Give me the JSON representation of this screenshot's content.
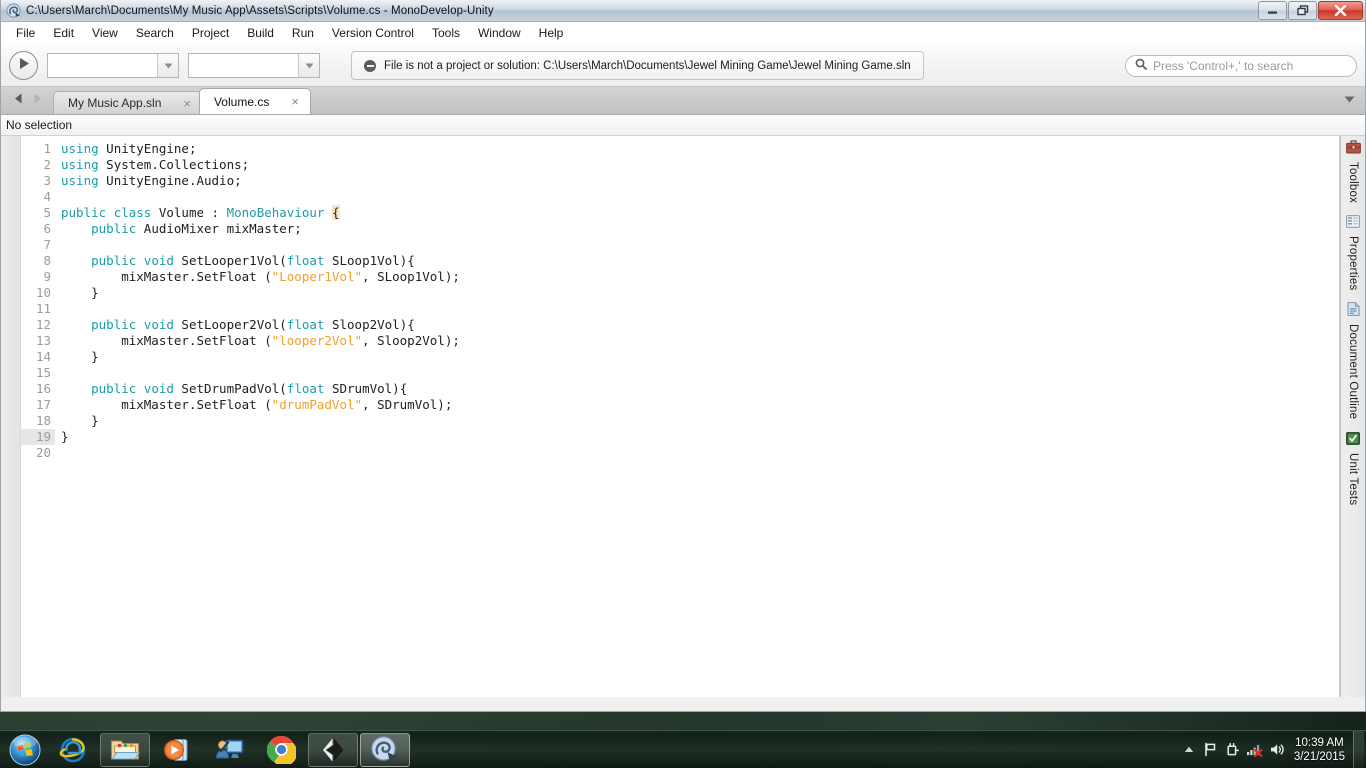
{
  "window": {
    "title": "C:\\Users\\March\\Documents\\My Music App\\Assets\\Scripts\\Volume.cs - MonoDevelop-Unity",
    "app_icon": "monodevelop-icon",
    "controls": {
      "minimize": "minimize-icon",
      "restore": "restore-icon",
      "close": "close-icon"
    }
  },
  "menubar": {
    "items": [
      {
        "label": "File"
      },
      {
        "label": "Edit"
      },
      {
        "label": "View"
      },
      {
        "label": "Search"
      },
      {
        "label": "Project"
      },
      {
        "label": "Build"
      },
      {
        "label": "Run"
      },
      {
        "label": "Version Control"
      },
      {
        "label": "Tools"
      },
      {
        "label": "Window"
      },
      {
        "label": "Help"
      }
    ]
  },
  "toolbar": {
    "run_button": "run-play-icon",
    "combo_configuration": {
      "value": "",
      "arrow": "chevron-down-icon"
    },
    "combo_target": {
      "value": "",
      "arrow": "chevron-down-icon"
    },
    "status": {
      "icon": "error-minus-icon",
      "message": "File is not a project or solution: C:\\Users\\March\\Documents\\Jewel Mining Game\\Jewel Mining Game.sln"
    },
    "search": {
      "icon": "search-icon",
      "placeholder": "Press 'Control+,' to search",
      "value": ""
    }
  },
  "tabs": {
    "nav_back": "arrow-left-icon",
    "nav_forward": "arrow-right-icon",
    "overflow": "chevron-down-icon",
    "items": [
      {
        "label": "My Music App.sln",
        "active": false,
        "close": "×"
      },
      {
        "label": "Volume.cs",
        "active": true,
        "close": "×"
      }
    ]
  },
  "selection_bar": {
    "text": "No selection"
  },
  "editor": {
    "current_line": 19,
    "total_lines": 20,
    "line_numbers": [
      "1",
      "2",
      "3",
      "4",
      "5",
      "6",
      "7",
      "8",
      "9",
      "10",
      "11",
      "12",
      "13",
      "14",
      "15",
      "16",
      "17",
      "18",
      "19",
      "20"
    ],
    "code_lines": [
      "using UnityEngine;",
      "using System.Collections;",
      "using UnityEngine.Audio;",
      "",
      "public class Volume : MonoBehaviour {",
      "    public AudioMixer mixMaster;",
      "",
      "    public void SetLooper1Vol(float SLoop1Vol){",
      "        mixMaster.SetFloat (\"Looper1Vol\", SLoop1Vol);",
      "    }",
      "",
      "    public void SetLooper2Vol(float Sloop2Vol){",
      "        mixMaster.SetFloat (\"looper2Vol\", Sloop2Vol);",
      "    }",
      "",
      "    public void SetDrumPadVol(float SDrumVol){",
      "        mixMaster.SetFloat (\"drumPadVol\", SDrumVol);",
      "    }",
      "}",
      ""
    ],
    "syntax_colors": {
      "keyword": "#1e9ca8",
      "string": "#f0a030",
      "text": "#1f1f1f",
      "line_number": "#9b9b9b",
      "bracket_match_bg": "#fde3bf"
    }
  },
  "pads": {
    "items": [
      {
        "label": "Toolbox",
        "icon": "toolbox-icon"
      },
      {
        "label": "Properties",
        "icon": "properties-grid-icon"
      },
      {
        "label": "Document Outline",
        "icon": "document-outline-icon"
      },
      {
        "label": "Unit Tests",
        "icon": "unit-tests-icon"
      }
    ]
  },
  "taskbar": {
    "start": "windows-start-orb-icon",
    "items": [
      {
        "name": "internet-explorer-icon",
        "state": "pinned-plain"
      },
      {
        "name": "file-explorer-icon",
        "state": "pinned-box"
      },
      {
        "name": "windows-media-player-icon",
        "state": "pinned-plain"
      },
      {
        "name": "remote-assistance-icon",
        "state": "pinned-plain"
      },
      {
        "name": "google-chrome-icon",
        "state": "pinned-plain"
      },
      {
        "name": "unity-editor-icon",
        "state": "pinned-box"
      },
      {
        "name": "monodevelop-icon",
        "state": "active-box"
      }
    ],
    "tray": {
      "show_hidden": "chevron-up-icon",
      "icons": [
        {
          "name": "action-center-flag-icon"
        },
        {
          "name": "power-plug-icon"
        },
        {
          "name": "network-disconnected-icon"
        },
        {
          "name": "volume-speaker-icon"
        }
      ],
      "clock_time": "10:39 AM",
      "clock_date": "3/21/2015"
    },
    "show_desktop": "show-desktop-button"
  }
}
